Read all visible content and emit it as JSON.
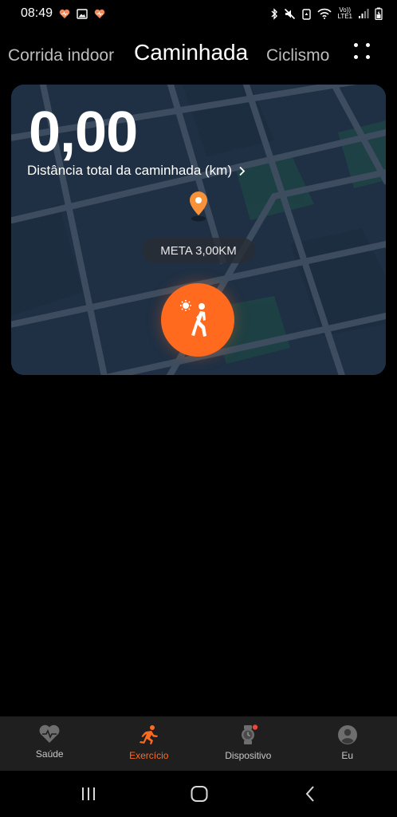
{
  "status_bar": {
    "time": "08:49",
    "network_label_top": "Vo))",
    "network_label_bottom": "LTE1"
  },
  "tabs": {
    "left": "Corrida indoor",
    "active": "Caminhada",
    "right": "Ciclismo"
  },
  "workout_card": {
    "distance_value": "0,00",
    "distance_label": "Distância total da caminhada (km)",
    "goal_label": "META 3,00KM"
  },
  "bottom_nav": {
    "items": [
      {
        "label": "Saúde",
        "icon": "heart-rate-icon"
      },
      {
        "label": "Exercício",
        "icon": "running-icon",
        "active": true
      },
      {
        "label": "Dispositivo",
        "icon": "watch-icon",
        "badge": true
      },
      {
        "label": "Eu",
        "icon": "profile-icon"
      }
    ]
  },
  "colors": {
    "accent": "#ff6a1e",
    "map_background": "#203347",
    "nav_background": "#1f1f1f"
  }
}
